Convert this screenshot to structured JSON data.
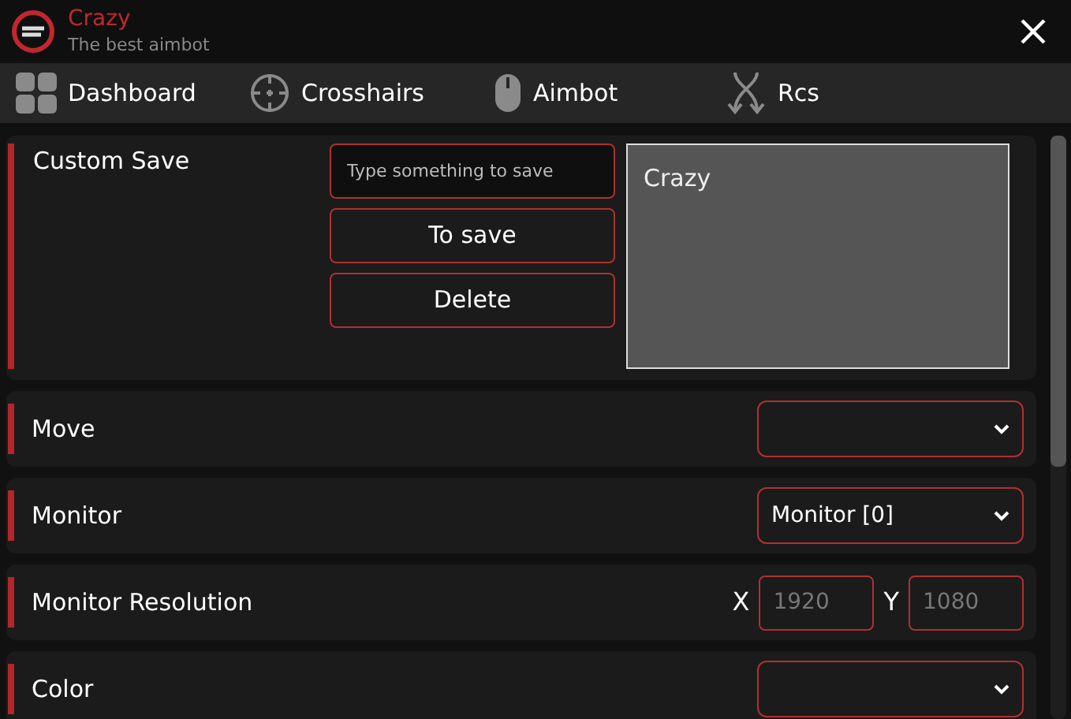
{
  "window": {
    "title": "Crazy",
    "subtitle": "The best aimbot"
  },
  "tabs": [
    {
      "label": "Dashboard",
      "kind": "grid"
    },
    {
      "label": "Crosshairs",
      "kind": "crosshair"
    },
    {
      "label": "Aimbot",
      "kind": "mouse"
    },
    {
      "label": "Rcs",
      "kind": "arrows"
    }
  ],
  "custom_save": {
    "label": "Custom Save",
    "placeholder": "Type something to save",
    "buttons": [
      "To save",
      "Delete"
    ],
    "list": [
      "Crazy"
    ]
  },
  "settings": [
    {
      "label": "Move",
      "kind": "dropdown"
    },
    {
      "label": "Monitor",
      "kind": "dropdown",
      "value": "Monitor [0]"
    },
    {
      "label": "Monitor Resolution",
      "kind": "xy",
      "x_label": "X",
      "x_placeholder": "1920",
      "y_label": "Y",
      "y_placeholder": "1080"
    },
    {
      "label": "Color",
      "kind": "dropdown"
    }
  ]
}
